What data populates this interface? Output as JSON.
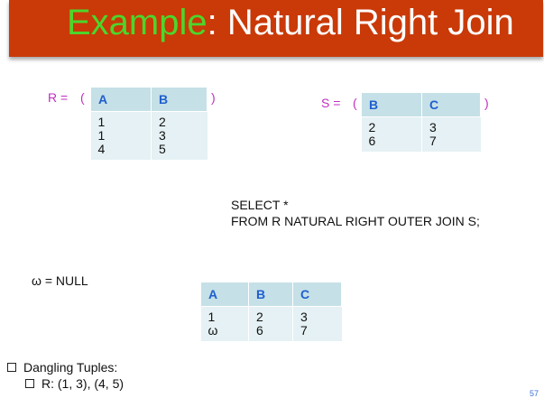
{
  "slide": {
    "title_highlight": "Example",
    "title_rest": ": Natural Right Join",
    "page_number": "57"
  },
  "relation_r": {
    "label": "R =",
    "open_paren": "(",
    "close_paren": ")",
    "headers": [
      "A",
      "B"
    ],
    "rows": [
      [
        "1",
        "2"
      ],
      [
        "1",
        "3"
      ],
      [
        "4",
        "5"
      ]
    ]
  },
  "relation_s": {
    "label": "S =",
    "open_paren": "(",
    "close_paren": ")",
    "headers": [
      "B",
      "C"
    ],
    "rows": [
      [
        "2",
        "3"
      ],
      [
        "6",
        "7"
      ]
    ]
  },
  "query": {
    "line1": "SELECT *",
    "line2": "FROM R NATURAL RIGHT OUTER JOIN S;"
  },
  "null_note": "ω = NULL",
  "result": {
    "headers": [
      "A",
      "B",
      "C"
    ],
    "rows": [
      [
        "1",
        "2",
        "3"
      ],
      [
        "ω",
        "6",
        "7"
      ]
    ]
  },
  "bullets": {
    "main": "Dangling Tuples:",
    "sub": "R: (1, 3), (4, 5)"
  }
}
